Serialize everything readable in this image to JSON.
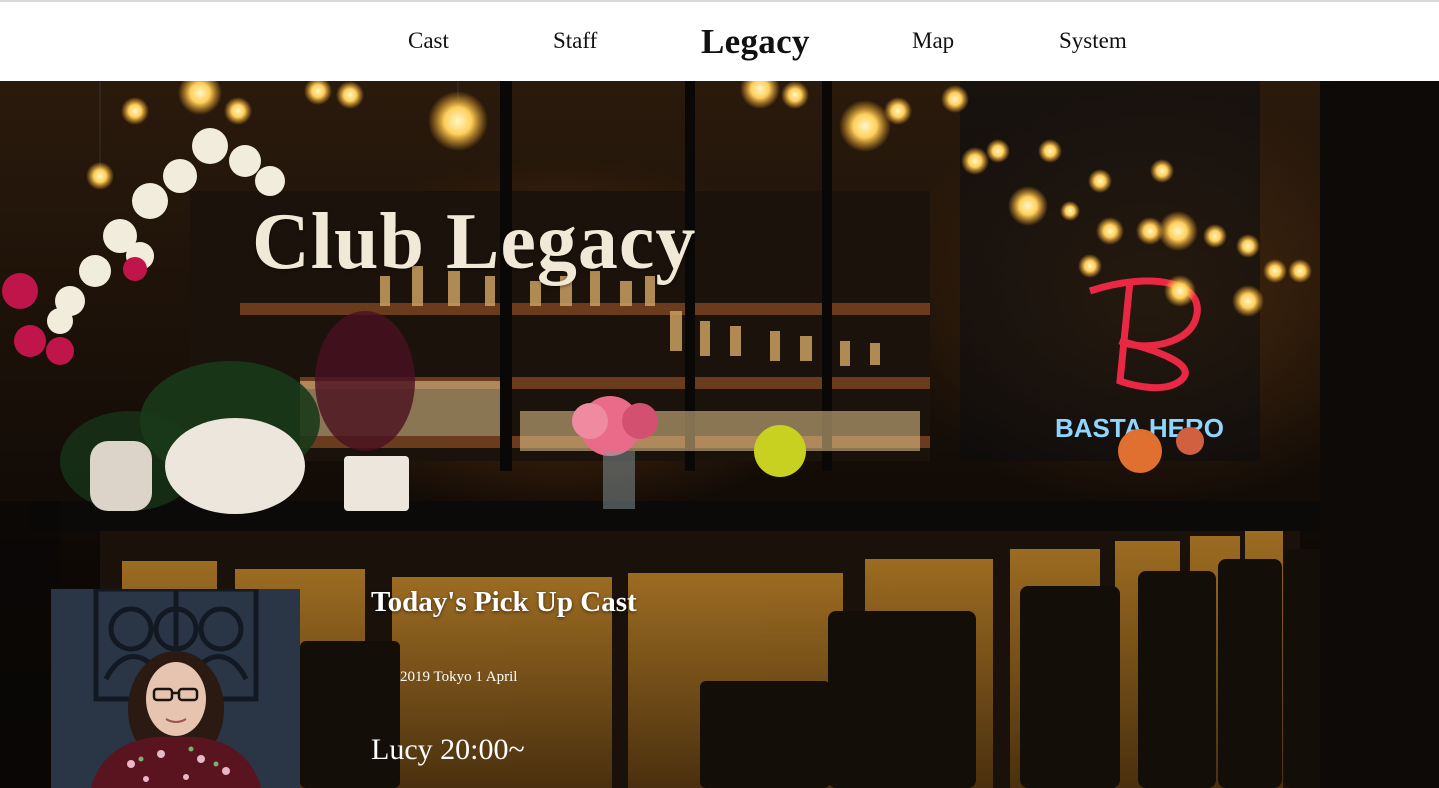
{
  "nav": {
    "items": [
      {
        "label": "Cast",
        "active": false
      },
      {
        "label": "Staff",
        "active": false
      },
      {
        "label": "Legacy",
        "active": true
      },
      {
        "label": "Map",
        "active": false
      },
      {
        "label": "System",
        "active": false
      }
    ]
  },
  "hero": {
    "title": "Club Legacy",
    "neon_sign": "BASTA HERO"
  },
  "pickup": {
    "heading": "Today's Pick Up Cast",
    "date": "2019 Tokyo 1 April",
    "cast_name_time": "Lucy 20:00~"
  },
  "colors": {
    "nav_bg": "#ffffff",
    "nav_text": "#111111",
    "title_text": "#f1e8d8",
    "neon_red": "#ff2a4a",
    "neon_blue": "#8fd6ff"
  }
}
